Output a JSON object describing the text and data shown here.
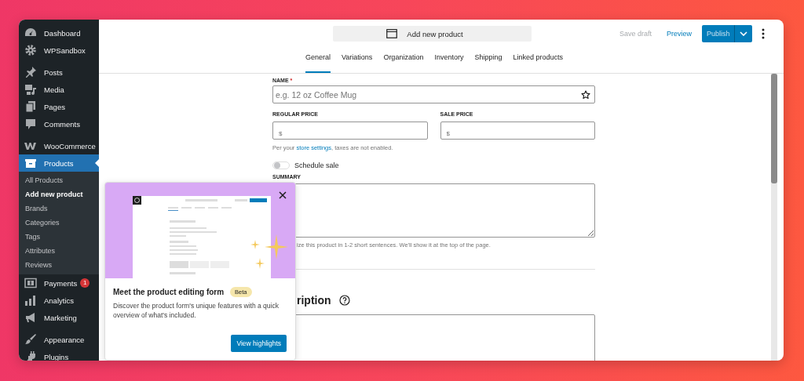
{
  "sidebar": {
    "sections": [
      {
        "items": [
          {
            "label": "Dashboard",
            "selected": false
          },
          {
            "label": "WPSandbox",
            "selected": false
          }
        ]
      },
      {
        "items": [
          {
            "label": "Posts",
            "selected": false
          },
          {
            "label": "Media",
            "selected": false
          },
          {
            "label": "Pages",
            "selected": false
          },
          {
            "label": "Comments",
            "selected": false
          }
        ]
      },
      {
        "items": [
          {
            "label": "WooCommerce",
            "selected": false
          },
          {
            "label": "Products",
            "selected": true,
            "expanded": true,
            "children": [
              {
                "label": "All Products",
                "selected": false
              },
              {
                "label": "Add new product",
                "selected": true
              },
              {
                "label": "Brands",
                "selected": false
              },
              {
                "label": "Categories",
                "selected": false
              },
              {
                "label": "Tags",
                "selected": false
              },
              {
                "label": "Attributes",
                "selected": false
              },
              {
                "label": "Reviews",
                "selected": false
              }
            ]
          }
        ]
      },
      {
        "items": [
          {
            "label": "Payments",
            "selected": false,
            "badge": "1"
          },
          {
            "label": "Analytics",
            "selected": false
          },
          {
            "label": "Marketing",
            "selected": false
          }
        ]
      },
      {
        "items": [
          {
            "label": "Appearance",
            "selected": false
          },
          {
            "label": "Plugins",
            "selected": false
          }
        ]
      }
    ]
  },
  "header": {
    "title": "Add new product",
    "save_draft": "Save draft",
    "preview": "Preview",
    "publish": "Publish"
  },
  "tabs": [
    {
      "label": "General",
      "selected": true
    },
    {
      "label": "Variations",
      "selected": false
    },
    {
      "label": "Organization",
      "selected": false
    },
    {
      "label": "Inventory",
      "selected": false
    },
    {
      "label": "Shipping",
      "selected": false
    },
    {
      "label": "Linked products",
      "selected": false
    }
  ],
  "form": {
    "name": {
      "label": "NAME",
      "required_mark": "*",
      "placeholder": "e.g. 12 oz Coffee Mug"
    },
    "regular_price": {
      "label": "REGULAR PRICE",
      "prefix": "$"
    },
    "sale_price": {
      "label": "SALE PRICE",
      "prefix": "$"
    },
    "tax_note": {
      "before": "Per your ",
      "link": "store settings",
      "after": ", taxes are not enabled."
    },
    "schedule_sale": {
      "label": "Schedule sale",
      "on": false
    },
    "summary": {
      "label": "SUMMARY",
      "help": "ize this product in 1-2 short sentences. We'll show it at the top of the page."
    },
    "description": {
      "heading": "ription"
    }
  },
  "popup": {
    "title": "Meet the product editing form",
    "badge": "Beta",
    "body": "Discover the product form's unique features with a quick overview of what's included.",
    "button": "View highlights"
  }
}
